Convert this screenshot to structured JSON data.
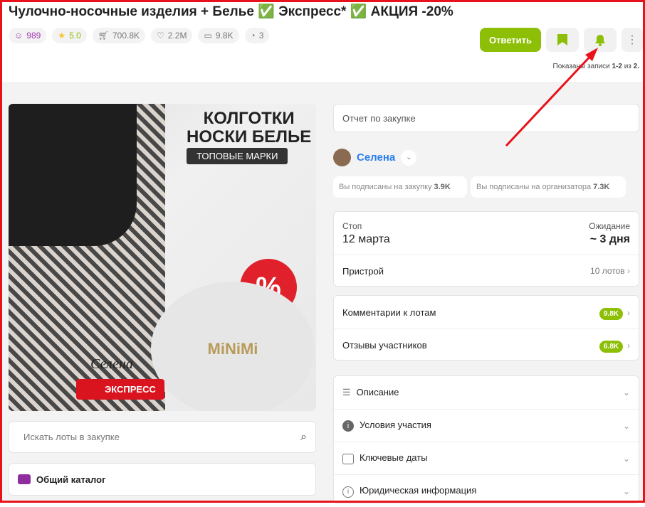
{
  "title": "Чулочно-носочные изделия + Белье ✅ Экспресс* ✅ АКЦИЯ -20%",
  "stats": [
    {
      "icon": "smile-icon",
      "value": "989",
      "color": "#a03cb0"
    },
    {
      "icon": "star-icon",
      "value": "5.0",
      "color": "#8dbf06"
    },
    {
      "icon": "cart-icon",
      "value": "700.8K",
      "color": "#777"
    },
    {
      "icon": "heart-icon",
      "value": "2.2M",
      "color": "#777"
    },
    {
      "icon": "comment-icon",
      "value": "9.8K",
      "color": "#777"
    },
    {
      "icon": "clock-icon",
      "value": "3",
      "color": "#777"
    }
  ],
  "actions": {
    "reply": "Ответить",
    "more": "⋮"
  },
  "records": {
    "prefix": "Показаны записи ",
    "range": "1-2",
    "mid": " из ",
    "total": "2."
  },
  "banner": {
    "line1": "КОЛГОТКИ",
    "line2": "НОСКИ БЕЛЬЕ",
    "tag": "ТОПОВЫЕ МАРКИ",
    "signature": "Селена",
    "express": "ЭКСПРЕСС",
    "brand": "MiNiMi",
    "percent": "%"
  },
  "search": {
    "placeholder": "Искать лоты в закупке"
  },
  "catalog": "Общий каталог",
  "report": "Отчет по закупке",
  "organizer": {
    "name": "Селена"
  },
  "subscriptions": [
    {
      "label": "Вы подписаны на закупку",
      "value": "3.9K"
    },
    {
      "label": "Вы подписаны на организатора",
      "value": "7.3K"
    }
  ],
  "stop": {
    "label": "Стоп",
    "value": "12 марта"
  },
  "waiting": {
    "label": "Ожидание",
    "value": "~ 3 дня"
  },
  "pristroy": {
    "label": "Пристрой",
    "value": "10 лотов"
  },
  "feedback": [
    {
      "label": "Комментарии к лотам",
      "value": "9.8K"
    },
    {
      "label": "Отзывы участников",
      "value": "6.8K"
    }
  ],
  "sections": [
    {
      "icon": "menu-icon",
      "label": "Описание"
    },
    {
      "icon": "info-icon",
      "label": "Условия участия"
    },
    {
      "icon": "calendar-icon",
      "label": "Ключевые даты"
    },
    {
      "icon": "info-outline-icon",
      "label": "Юридическая информация"
    }
  ],
  "colors": {
    "accent": "#8dbf06",
    "link": "#2a7ef0",
    "annotation": "#e8121a"
  }
}
